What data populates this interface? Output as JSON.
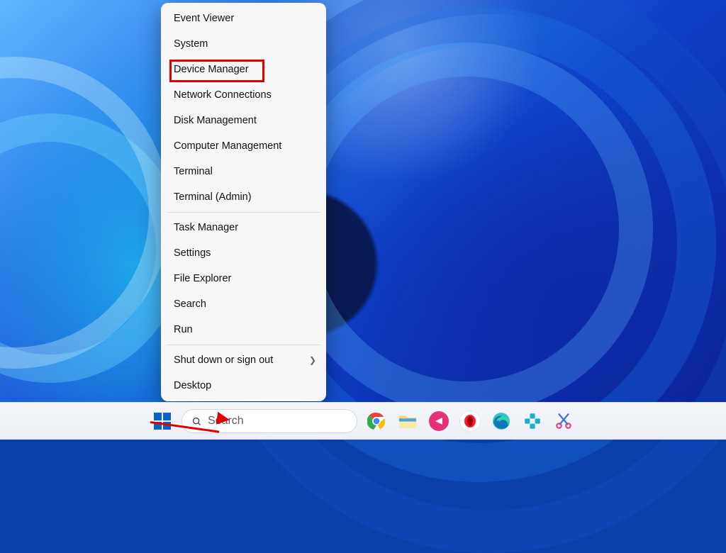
{
  "power_menu": {
    "highlighted_index": 2,
    "groups": [
      [
        {
          "label": "Event Viewer"
        },
        {
          "label": "System"
        },
        {
          "label": "Device Manager"
        },
        {
          "label": "Network Connections"
        },
        {
          "label": "Disk Management"
        },
        {
          "label": "Computer Management"
        },
        {
          "label": "Terminal"
        },
        {
          "label": "Terminal (Admin)"
        }
      ],
      [
        {
          "label": "Task Manager"
        },
        {
          "label": "Settings"
        },
        {
          "label": "File Explorer"
        },
        {
          "label": "Search"
        },
        {
          "label": "Run"
        }
      ],
      [
        {
          "label": "Shut down or sign out",
          "submenu": true
        },
        {
          "label": "Desktop"
        }
      ]
    ]
  },
  "taskbar": {
    "search_placeholder": "Search",
    "pinned": [
      {
        "name": "start",
        "semantic": "start-button"
      },
      {
        "name": "search",
        "semantic": "search-box"
      },
      {
        "name": "chrome",
        "semantic": "chrome-icon"
      },
      {
        "name": "file-explorer",
        "semantic": "file-explorer-icon"
      },
      {
        "name": "dashlane",
        "semantic": "dashlane-icon"
      },
      {
        "name": "opera",
        "semantic": "opera-icon"
      },
      {
        "name": "edge",
        "semantic": "edge-icon"
      },
      {
        "name": "app-teal",
        "semantic": "app-icon"
      },
      {
        "name": "snip",
        "semantic": "snipping-tool-icon"
      }
    ]
  },
  "annotation": {
    "highlight_target": "Device Manager",
    "arrow_target": "Start button"
  }
}
